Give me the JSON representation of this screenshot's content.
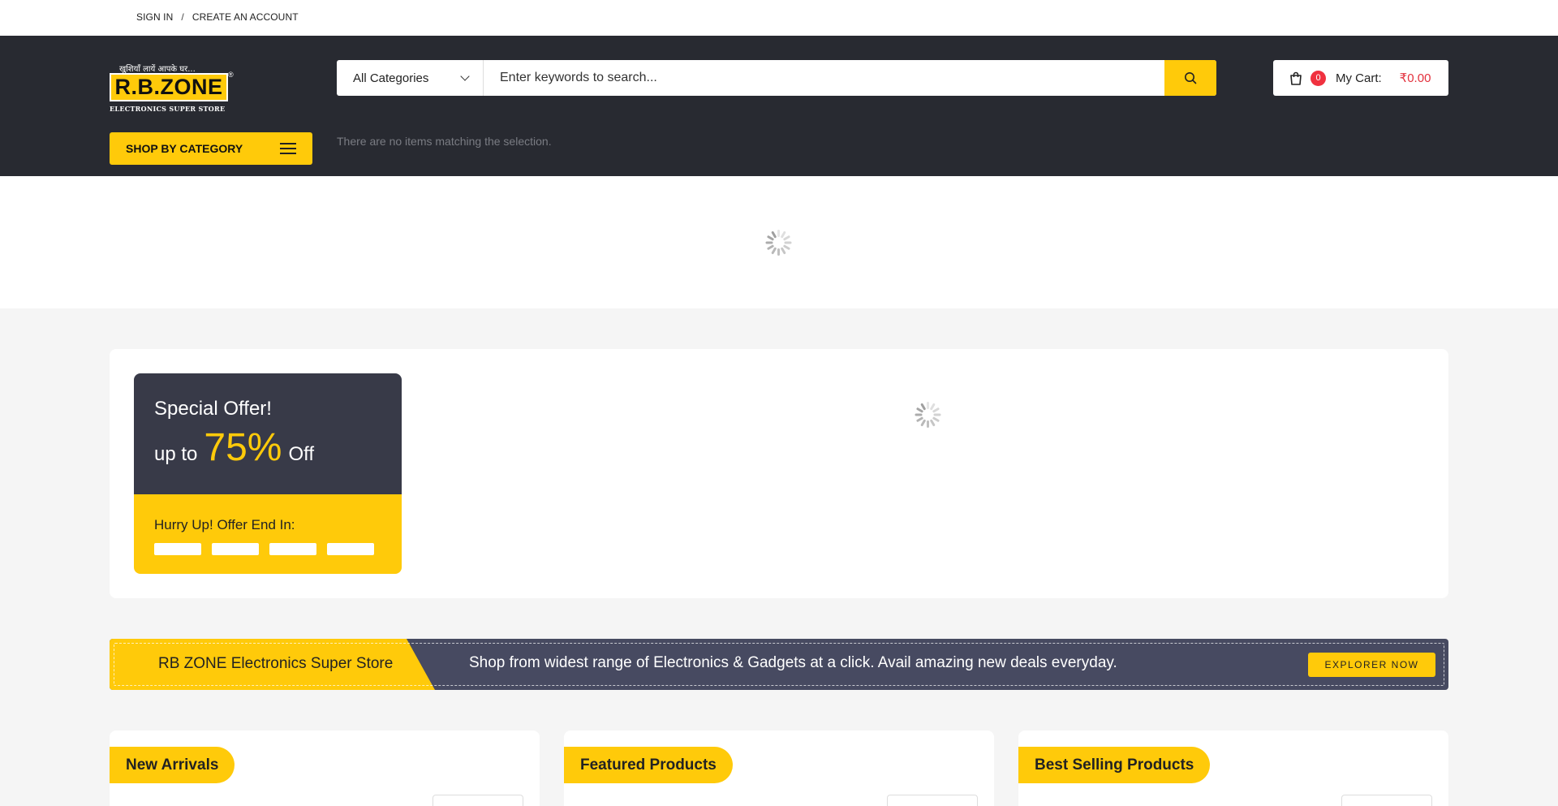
{
  "topbar": {
    "sign_in": "SIGN IN",
    "separator": "/",
    "create_account": "CREATE AN ACCOUNT"
  },
  "logo": {
    "tagline": "खुशियाँ लायें आपके घर...",
    "name": "R.B.ZONE",
    "registered": "®",
    "subtitle": "ELECTRONICS SUPER STORE"
  },
  "search": {
    "category": "All Categories",
    "placeholder": "Enter keywords to search...",
    "icon": "search-icon"
  },
  "cart": {
    "count": "0",
    "label": "My Cart:",
    "total": "₹0.00",
    "icon": "shopping-bag-icon"
  },
  "shop_by_category": {
    "label": "SHOP BY CATEGORY",
    "icon": "hamburger-menu-icon"
  },
  "search_status": "There are no items matching the selection.",
  "offer": {
    "title": "Special Offer!",
    "up_to": "up to",
    "percent": "75%",
    "off": "Off",
    "hurry": "Hurry Up! Offer End In:"
  },
  "banner": {
    "store_name": "RB ZONE Electronics Super Store",
    "message": "Shop from widest range of Electronics & Gadgets at a click. Avail amazing new deals everyday.",
    "button": "EXPLORER NOW"
  },
  "sections": [
    {
      "title": "New Arrivals"
    },
    {
      "title": "Featured Products"
    },
    {
      "title": "Best Selling Products"
    }
  ],
  "colors": {
    "accent": "#ffca0a",
    "header_bg": "#282a31",
    "offer_dark": "#383a48",
    "banner_bg": "#474a61",
    "cart_badge": "#f0313f",
    "price": "#e3303c"
  }
}
